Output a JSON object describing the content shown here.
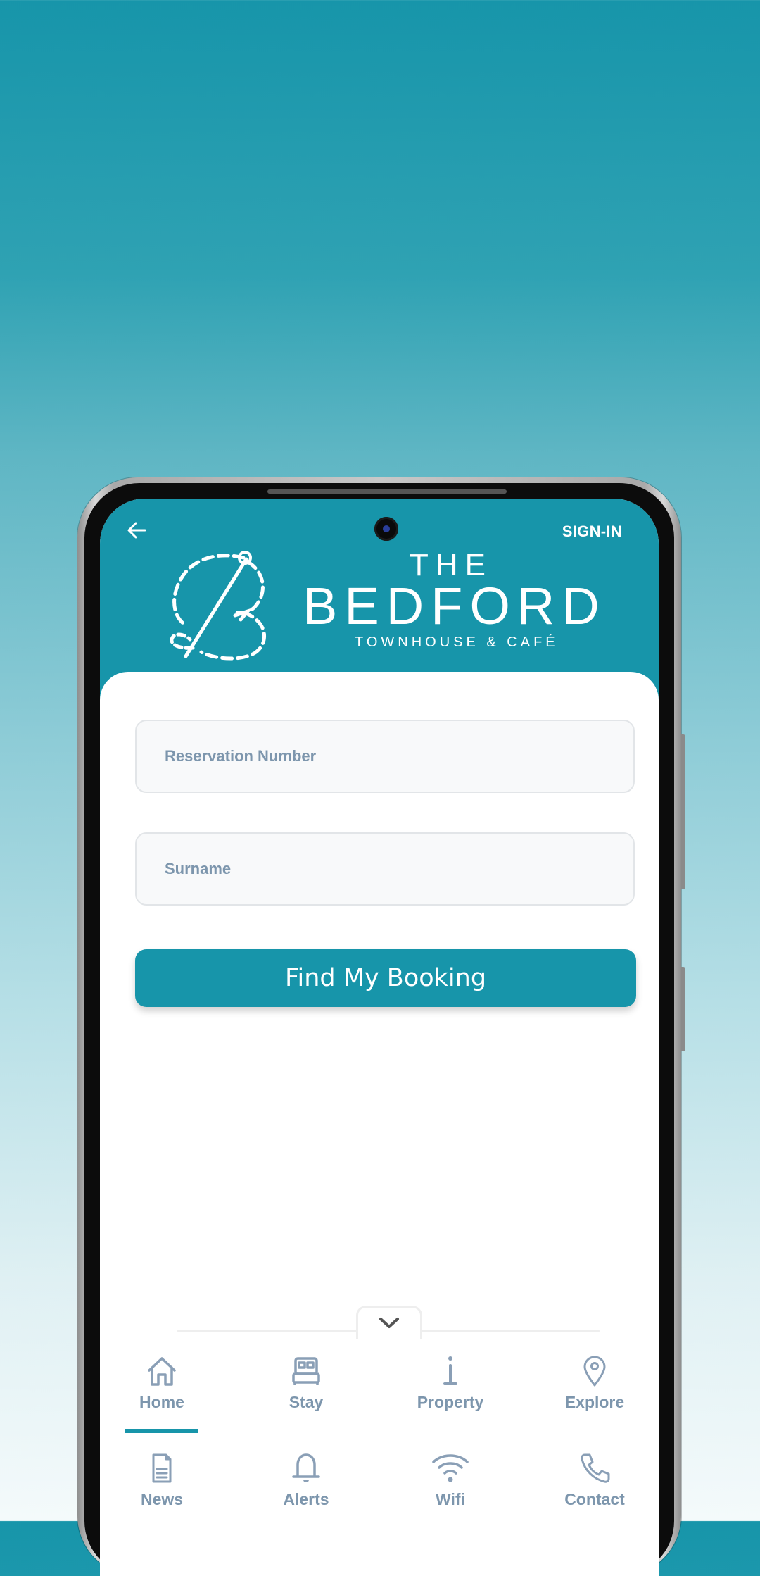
{
  "header": {
    "back_label": "back",
    "signin_label": "SIGN-IN",
    "brand": {
      "the": "THE",
      "name": "BEDFORD",
      "subtitle": "TOWNHOUSE & CAFÉ"
    }
  },
  "form": {
    "reservation_placeholder": "Reservation Number",
    "reservation_value": "",
    "surname_placeholder": "Surname",
    "surname_value": "",
    "submit_label": "Find My Booking"
  },
  "nav": {
    "active": "Home",
    "items": [
      {
        "label": "Home",
        "icon": "home-icon"
      },
      {
        "label": "Stay",
        "icon": "bed-icon"
      },
      {
        "label": "Property",
        "icon": "info-icon"
      },
      {
        "label": "Explore",
        "icon": "map-pin-icon"
      },
      {
        "label": "News",
        "icon": "document-icon"
      },
      {
        "label": "Alerts",
        "icon": "bell-icon"
      },
      {
        "label": "Wifi",
        "icon": "wifi-icon"
      },
      {
        "label": "Contact",
        "icon": "phone-icon"
      }
    ]
  },
  "colors": {
    "brand": "#1795aa",
    "nav_text": "#7d96ad",
    "field_bg": "#f8f9fa",
    "field_border": "#e2e5e8"
  }
}
